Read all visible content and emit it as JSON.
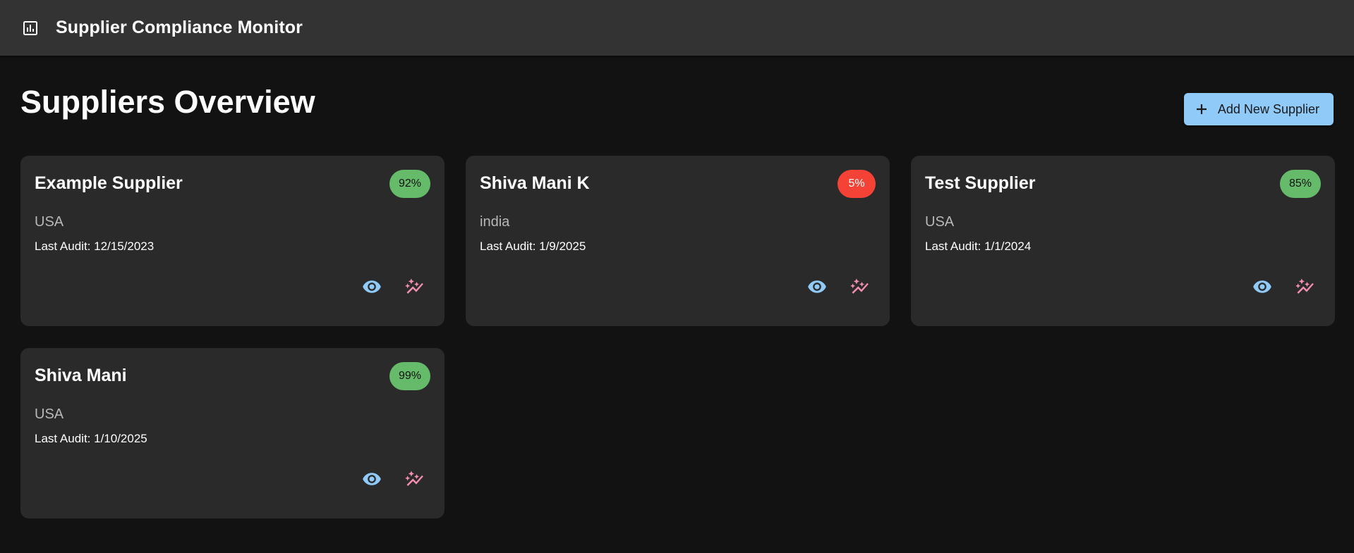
{
  "app": {
    "title": "Supplier Compliance Monitor",
    "logo_icon": "bar-chart-icon"
  },
  "page": {
    "title": "Suppliers Overview",
    "add_button_label": "Add New Supplier",
    "add_button_icon": "plus-icon"
  },
  "colors": {
    "appbar": "#333333",
    "background": "#121212",
    "card": "#2a2a2a",
    "primary": "#90caf9",
    "view_icon": "#90caf9",
    "analytics_icon": "#f48fb1",
    "score_good": "#66bb6a",
    "score_bad": "#f44336"
  },
  "suppliers": [
    {
      "name": "Example Supplier",
      "score": "92%",
      "status": "good",
      "country": "USA",
      "audit": "Last Audit: 12/15/2023"
    },
    {
      "name": "Shiva Mani K",
      "score": "5%",
      "status": "bad",
      "country": "india",
      "audit": "Last Audit: 1/9/2025"
    },
    {
      "name": "Test Supplier",
      "score": "85%",
      "status": "good",
      "country": "USA",
      "audit": "Last Audit: 1/1/2024"
    },
    {
      "name": "Shiva Mani",
      "score": "99%",
      "status": "good",
      "country": "USA",
      "audit": "Last Audit: 1/10/2025"
    }
  ],
  "card_actions": {
    "view_icon": "eye-icon",
    "analytics_icon": "auto-graph-icon"
  }
}
